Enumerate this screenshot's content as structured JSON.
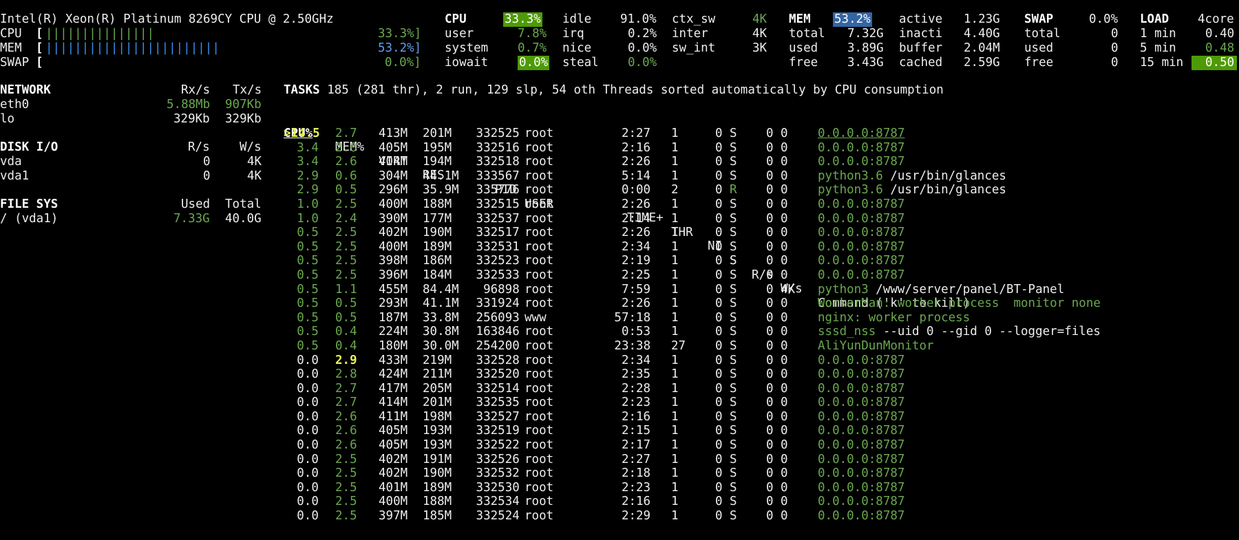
{
  "cpu_model": "Intel(R) Xeon(R) Platinum 8269CY CPU @ 2.50GHz",
  "quicklook": {
    "cpu_label": "CPU",
    "cpu_bar": "|||||||||||||||",
    "cpu_pct": "33.3%]",
    "mem_label": "MEM",
    "mem_bar": "||||||||||||||||||||||||",
    "mem_pct": "53.2%]",
    "swap_label": "SWAP",
    "swap_pct": "0.0%]"
  },
  "cpu": {
    "title": "CPU",
    "total": "33.3%",
    "user_l": "user",
    "user_v": "7.8%",
    "system_l": "system",
    "system_v": "0.7%",
    "iowait_l": "iowait",
    "iowait_v": "0.0%",
    "idle_l": "idle",
    "idle_v": "91.0%",
    "irq_l": "irq",
    "irq_v": "0.2%",
    "nice_l": "nice",
    "nice_v": "0.0%",
    "steal_l": "steal",
    "steal_v": "0.0%",
    "ctx_l": "ctx_sw",
    "ctx_v": "4K",
    "inter_l": "inter",
    "inter_v": "4K",
    "swint_l": "sw_int",
    "swint_v": "3K"
  },
  "mem": {
    "title": "MEM",
    "pct": "53.2%",
    "total_l": "total",
    "total_v": "7.32G",
    "used_l": "used",
    "used_v": "3.89G",
    "free_l": "free",
    "free_v": "3.43G",
    "active_l": "active",
    "active_v": "1.23G",
    "inact_l": "inacti",
    "inact_v": "4.40G",
    "buffer_l": "buffer",
    "buffer_v": "2.04M",
    "cached_l": "cached",
    "cached_v": "2.59G"
  },
  "swap": {
    "title": "SWAP",
    "pct": "0.0%",
    "total_l": "total",
    "total_v": "0",
    "used_l": "used",
    "used_v": "0",
    "free_l": "free",
    "free_v": "0"
  },
  "load": {
    "title": "LOAD",
    "cores": "4core",
    "m1_l": "1 min",
    "m1_v": "0.40",
    "m5_l": "5 min",
    "m5_v": "0.48",
    "m15_l": "15 min",
    "m15_v": "0.50"
  },
  "network": {
    "title": "NETWORK",
    "rx_h": "Rx/s",
    "tx_h": "Tx/s",
    "rows": [
      {
        "name": "eth0",
        "rx": "5.88Mb",
        "tx": "907Kb"
      },
      {
        "name": "lo",
        "rx": "329Kb",
        "tx": "329Kb"
      }
    ]
  },
  "disk": {
    "title": "DISK I/O",
    "r_h": "R/s",
    "w_h": "W/s",
    "rows": [
      {
        "name": "vda",
        "r": "0",
        "w": "4K"
      },
      {
        "name": "vda1",
        "r": "0",
        "w": "4K"
      }
    ]
  },
  "fs": {
    "title": "FILE SYS",
    "used_h": "Used",
    "total_h": "Total",
    "rows": [
      {
        "name": "/ (vda1)",
        "used": "7.33G",
        "total": "40.0G"
      }
    ]
  },
  "tasks": {
    "label": "TASKS",
    "summary": "185 (281 thr), 2 run, 129 slp, 54 oth Threads sorted automatically by CPU consumption"
  },
  "proc_headers": {
    "cpu": "CPU%",
    "mem": "MEM%",
    "virt": "VIRT",
    "res": "RES",
    "pid": "PID",
    "user": "USER",
    "time": "TIME+",
    "thr": "THR",
    "ni": "NI",
    "s": "S",
    "rs": "R/s",
    "ws": "W/s",
    "cmd": "Command ('k' to kill)"
  },
  "processes": [
    {
      "cpu": ">14.5",
      "mem": "2.7",
      "virt": "413M",
      "res": "201M",
      "pid": "332525",
      "user": "root",
      "time": "2:27",
      "thr": "1",
      "ni": "0",
      "s": "S",
      "rs": "0",
      "ws": "0",
      "cmd": "0.0.0.0:8787",
      "args": ""
    },
    {
      "cpu": "3.4",
      "mem": "2.6",
      "virt": "405M",
      "res": "195M",
      "pid": "332516",
      "user": "root",
      "time": "2:16",
      "thr": "1",
      "ni": "0",
      "s": "S",
      "rs": "0",
      "ws": "0",
      "cmd": "0.0.0.0:8787",
      "args": ""
    },
    {
      "cpu": "3.4",
      "mem": "2.6",
      "virt": "404M",
      "res": "194M",
      "pid": "332518",
      "user": "root",
      "time": "2:26",
      "thr": "1",
      "ni": "0",
      "s": "S",
      "rs": "0",
      "ws": "0",
      "cmd": "0.0.0.0:8787",
      "args": ""
    },
    {
      "cpu": "2.9",
      "mem": "0.6",
      "virt": "304M",
      "res": "44.1M",
      "pid": "333567",
      "user": "root",
      "time": "5:14",
      "thr": "1",
      "ni": "0",
      "s": "S",
      "rs": "0",
      "ws": "0",
      "cmd": "python3.6",
      "args": "/usr/bin/glances"
    },
    {
      "cpu": "2.9",
      "mem": "0.5",
      "virt": "296M",
      "res": "35.9M",
      "pid": "335776",
      "user": "root",
      "time": "0:00",
      "thr": "2",
      "ni": "0",
      "s": "R",
      "rs": "0",
      "ws": "0",
      "cmd": "python3.6",
      "args": "/usr/bin/glances"
    },
    {
      "cpu": "1.0",
      "mem": "2.5",
      "virt": "400M",
      "res": "188M",
      "pid": "332515",
      "user": "root",
      "time": "2:26",
      "thr": "1",
      "ni": "0",
      "s": "S",
      "rs": "0",
      "ws": "0",
      "cmd": "0.0.0.0:8787",
      "args": ""
    },
    {
      "cpu": "1.0",
      "mem": "2.4",
      "virt": "390M",
      "res": "177M",
      "pid": "332537",
      "user": "root",
      "time": "2:14",
      "thr": "1",
      "ni": "0",
      "s": "S",
      "rs": "0",
      "ws": "0",
      "cmd": "0.0.0.0:8787",
      "args": ""
    },
    {
      "cpu": "0.5",
      "mem": "2.5",
      "virt": "402M",
      "res": "190M",
      "pid": "332517",
      "user": "root",
      "time": "2:26",
      "thr": "1",
      "ni": "0",
      "s": "S",
      "rs": "0",
      "ws": "0",
      "cmd": "0.0.0.0:8787",
      "args": ""
    },
    {
      "cpu": "0.5",
      "mem": "2.5",
      "virt": "400M",
      "res": "189M",
      "pid": "332531",
      "user": "root",
      "time": "2:34",
      "thr": "1",
      "ni": "0",
      "s": "S",
      "rs": "0",
      "ws": "0",
      "cmd": "0.0.0.0:8787",
      "args": ""
    },
    {
      "cpu": "0.5",
      "mem": "2.5",
      "virt": "398M",
      "res": "186M",
      "pid": "332523",
      "user": "root",
      "time": "2:19",
      "thr": "1",
      "ni": "0",
      "s": "S",
      "rs": "0",
      "ws": "0",
      "cmd": "0.0.0.0:8787",
      "args": ""
    },
    {
      "cpu": "0.5",
      "mem": "2.5",
      "virt": "396M",
      "res": "184M",
      "pid": "332533",
      "user": "root",
      "time": "2:25",
      "thr": "1",
      "ni": "0",
      "s": "S",
      "rs": "0",
      "ws": "0",
      "cmd": "0.0.0.0:8787",
      "args": ""
    },
    {
      "cpu": "0.5",
      "mem": "1.1",
      "virt": "455M",
      "res": "84.4M",
      "pid": "96898",
      "user": "root",
      "time": "7:59",
      "thr": "1",
      "ni": "0",
      "s": "S",
      "rs": "0",
      "ws": "4K",
      "cmd": "python3",
      "args": "/www/server/panel/BT-Panel"
    },
    {
      "cpu": "0.5",
      "mem": "0.5",
      "virt": "293M",
      "res": "41.1M",
      "pid": "331924",
      "user": "root",
      "time": "2:26",
      "thr": "1",
      "ni": "0",
      "s": "S",
      "rs": "0",
      "ws": "0",
      "cmd": "WorkerMan: worker process  monitor none",
      "args": ""
    },
    {
      "cpu": "0.5",
      "mem": "0.5",
      "virt": "187M",
      "res": "33.8M",
      "pid": "256093",
      "user": "www",
      "time": "57:18",
      "thr": "1",
      "ni": "0",
      "s": "S",
      "rs": "0",
      "ws": "0",
      "cmd": "nginx: worker process",
      "args": ""
    },
    {
      "cpu": "0.5",
      "mem": "0.4",
      "virt": "224M",
      "res": "30.8M",
      "pid": "163846",
      "user": "root",
      "time": "0:53",
      "thr": "1",
      "ni": "0",
      "s": "S",
      "rs": "0",
      "ws": "0",
      "cmd": "sssd_nss",
      "args": "--uid 0 --gid 0 --logger=files"
    },
    {
      "cpu": "0.5",
      "mem": "0.4",
      "virt": "180M",
      "res": "30.0M",
      "pid": "254200",
      "user": "root",
      "time": "23:38",
      "thr": "27",
      "ni": "0",
      "s": "S",
      "rs": "0",
      "ws": "0",
      "cmd": "AliYunDunMonitor",
      "args": ""
    },
    {
      "cpu": "0.0",
      "mem": "2.9",
      "virt": "433M",
      "res": "219M",
      "pid": "332528",
      "user": "root",
      "time": "2:34",
      "thr": "1",
      "ni": "0",
      "s": "S",
      "rs": "0",
      "ws": "0",
      "cmd": "0.0.0.0:8787",
      "args": ""
    },
    {
      "cpu": "0.0",
      "mem": "2.8",
      "virt": "424M",
      "res": "211M",
      "pid": "332520",
      "user": "root",
      "time": "2:35",
      "thr": "1",
      "ni": "0",
      "s": "S",
      "rs": "0",
      "ws": "0",
      "cmd": "0.0.0.0:8787",
      "args": ""
    },
    {
      "cpu": "0.0",
      "mem": "2.7",
      "virt": "417M",
      "res": "205M",
      "pid": "332514",
      "user": "root",
      "time": "2:28",
      "thr": "1",
      "ni": "0",
      "s": "S",
      "rs": "0",
      "ws": "0",
      "cmd": "0.0.0.0:8787",
      "args": ""
    },
    {
      "cpu": "0.0",
      "mem": "2.7",
      "virt": "414M",
      "res": "201M",
      "pid": "332535",
      "user": "root",
      "time": "2:23",
      "thr": "1",
      "ni": "0",
      "s": "S",
      "rs": "0",
      "ws": "0",
      "cmd": "0.0.0.0:8787",
      "args": ""
    },
    {
      "cpu": "0.0",
      "mem": "2.6",
      "virt": "411M",
      "res": "198M",
      "pid": "332527",
      "user": "root",
      "time": "2:16",
      "thr": "1",
      "ni": "0",
      "s": "S",
      "rs": "0",
      "ws": "0",
      "cmd": "0.0.0.0:8787",
      "args": ""
    },
    {
      "cpu": "0.0",
      "mem": "2.6",
      "virt": "405M",
      "res": "193M",
      "pid": "332519",
      "user": "root",
      "time": "2:15",
      "thr": "1",
      "ni": "0",
      "s": "S",
      "rs": "0",
      "ws": "0",
      "cmd": "0.0.0.0:8787",
      "args": ""
    },
    {
      "cpu": "0.0",
      "mem": "2.6",
      "virt": "405M",
      "res": "193M",
      "pid": "332522",
      "user": "root",
      "time": "2:17",
      "thr": "1",
      "ni": "0",
      "s": "S",
      "rs": "0",
      "ws": "0",
      "cmd": "0.0.0.0:8787",
      "args": ""
    },
    {
      "cpu": "0.0",
      "mem": "2.5",
      "virt": "402M",
      "res": "191M",
      "pid": "332526",
      "user": "root",
      "time": "2:27",
      "thr": "1",
      "ni": "0",
      "s": "S",
      "rs": "0",
      "ws": "0",
      "cmd": "0.0.0.0:8787",
      "args": ""
    },
    {
      "cpu": "0.0",
      "mem": "2.5",
      "virt": "402M",
      "res": "190M",
      "pid": "332532",
      "user": "root",
      "time": "2:18",
      "thr": "1",
      "ni": "0",
      "s": "S",
      "rs": "0",
      "ws": "0",
      "cmd": "0.0.0.0:8787",
      "args": ""
    },
    {
      "cpu": "0.0",
      "mem": "2.5",
      "virt": "401M",
      "res": "189M",
      "pid": "332530",
      "user": "root",
      "time": "2:23",
      "thr": "1",
      "ni": "0",
      "s": "S",
      "rs": "0",
      "ws": "0",
      "cmd": "0.0.0.0:8787",
      "args": ""
    },
    {
      "cpu": "0.0",
      "mem": "2.5",
      "virt": "400M",
      "res": "188M",
      "pid": "332534",
      "user": "root",
      "time": "2:16",
      "thr": "1",
      "ni": "0",
      "s": "S",
      "rs": "0",
      "ws": "0",
      "cmd": "0.0.0.0:8787",
      "args": ""
    },
    {
      "cpu": "0.0",
      "mem": "2.5",
      "virt": "397M",
      "res": "185M",
      "pid": "332524",
      "user": "root",
      "time": "2:29",
      "thr": "1",
      "ni": "0",
      "s": "S",
      "rs": "0",
      "ws": "0",
      "cmd": "0.0.0.0:8787",
      "args": ""
    }
  ]
}
